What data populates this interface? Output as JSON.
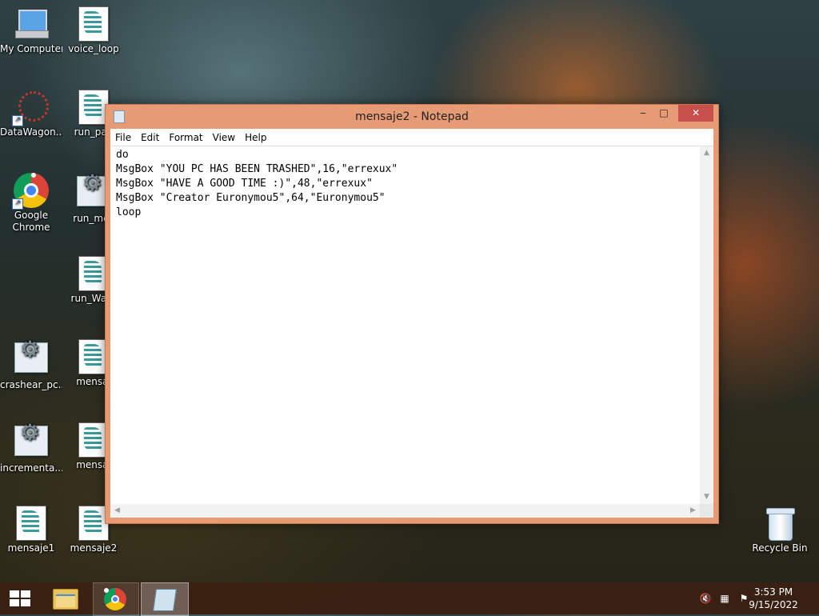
{
  "desktop": {
    "icons": [
      {
        "label": "My Computer"
      },
      {
        "label": "voice_loop"
      },
      {
        "label": "DataWagon..."
      },
      {
        "label": "run_pag"
      },
      {
        "label": "Google Chrome"
      },
      {
        "label": "run_mes"
      },
      {
        "label": "run_Warn"
      },
      {
        "label": "crashear_pc..."
      },
      {
        "label": "mensaj"
      },
      {
        "label": "incrementa..."
      },
      {
        "label": "mensaj"
      },
      {
        "label": "mensaje1"
      },
      {
        "label": "mensaje2"
      },
      {
        "label": "Recycle Bin"
      }
    ]
  },
  "window": {
    "title": "mensaje2 - Notepad",
    "controls": {
      "minimize": "‒",
      "maximize": "□",
      "close": "✕"
    },
    "menu": [
      "File",
      "Edit",
      "Format",
      "View",
      "Help"
    ],
    "content_lines": [
      "do",
      "MsgBox \"YOU PC HAS BEEN TRASHED\",16,\"errexux\"",
      "MsgBox \"HAVE A GOOD TIME :)\",48,\"errexux\"",
      "MsgBox \"Creator Euronymou5\",64,\"Euronymou5\"",
      "loop"
    ]
  },
  "taskbar": {
    "items": [
      "start-button",
      "file-explorer",
      "google-chrome",
      "notepad"
    ],
    "tray": {
      "volume_icon": "speaker-muted-icon",
      "network_icon": "network-icon",
      "flag_icon": "action-center-flag-icon"
    },
    "clock": {
      "time": "3:53 PM",
      "date": "9/15/2022"
    }
  },
  "colors": {
    "window_frame": "#e79b75",
    "close_button": "#c7504a",
    "taskbar": "#3c2012"
  }
}
